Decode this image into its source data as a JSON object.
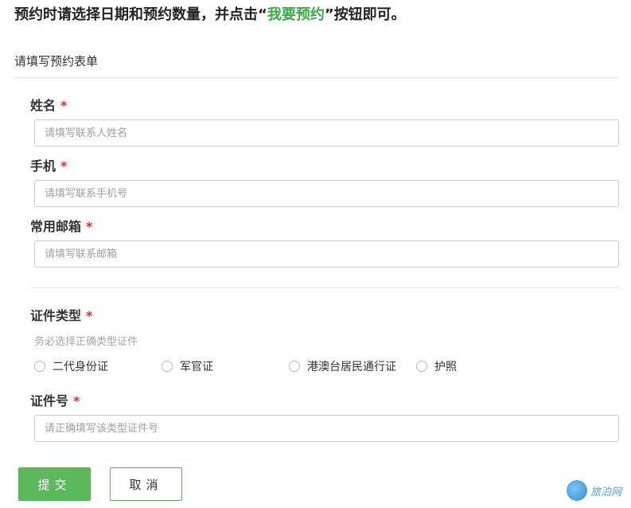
{
  "instruction": {
    "prefix": "预约时请选择日期和预约数量，并点击“",
    "highlight": "我要预约",
    "suffix": "”按钮即可。"
  },
  "form": {
    "title": "请填写预约表单",
    "required_mark": "*",
    "name": {
      "label": "姓名",
      "placeholder": "请填写联系人姓名",
      "value": ""
    },
    "phone": {
      "label": "手机",
      "placeholder": "请填写联系手机号",
      "value": ""
    },
    "email": {
      "label": "常用邮箱",
      "placeholder": "请填写联系邮箱",
      "value": ""
    },
    "id_type": {
      "label": "证件类型",
      "hint": "务必选择正确类型证件",
      "options": [
        "二代身份证",
        "军官证",
        "港澳台居民通行证",
        "护照"
      ]
    },
    "id_number": {
      "label": "证件号",
      "placeholder": "请正确填写该类型证件号",
      "value": ""
    }
  },
  "buttons": {
    "submit": "提交",
    "cancel": "取消"
  },
  "watermark": {
    "text": "旅泊网"
  },
  "colors": {
    "accent_green": "#39a845",
    "button_green": "#5cb85c",
    "required_red": "#d9312b"
  }
}
